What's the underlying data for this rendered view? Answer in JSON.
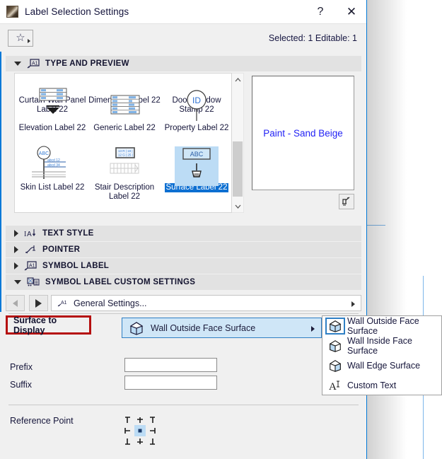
{
  "window": {
    "title": "Label Selection Settings",
    "icon": "archicad-label-icon",
    "help_label": "?",
    "close_label": "✕"
  },
  "toolbar": {
    "favorites_icon": "star-icon",
    "favorites_caret": "caret-right-icon",
    "selection_info": "Selected: 1 Editable: 1"
  },
  "panels": [
    {
      "title": "TYPE AND PREVIEW",
      "icon": "label-a1-icon",
      "expanded": true
    },
    {
      "title": "TEXT STYLE",
      "icon": "text-style-icon",
      "expanded": false
    },
    {
      "title": "POINTER",
      "icon": "pointer-icon",
      "expanded": false
    },
    {
      "title": "SYMBOL LABEL",
      "icon": "symbol-label-icon",
      "expanded": false
    },
    {
      "title": "SYMBOL LABEL CUSTOM SETTINGS",
      "icon": "custom-settings-icon",
      "expanded": true
    }
  ],
  "type_and_preview": {
    "items": [
      {
        "label": "Curtain Wall Panel Label 22",
        "icon": "curtain-wall-panel-label-icon",
        "selected": false,
        "clipped_top": true
      },
      {
        "label": "Dimension Label 22",
        "icon": "dimension-label-icon",
        "selected": false,
        "clipped_top": true
      },
      {
        "label": "Door Window Stamp 22",
        "icon": "door-window-stamp-icon",
        "selected": false,
        "clipped_top": true
      },
      {
        "label": "Elevation Label 22",
        "icon": "elevation-label-icon",
        "selected": false
      },
      {
        "label": "Generic Label 22",
        "icon": "generic-label-icon",
        "selected": false
      },
      {
        "label": "Property Label 22",
        "icon": "property-label-icon",
        "selected": false
      },
      {
        "label": "Skin List Label 22",
        "icon": "skin-list-label-icon",
        "selected": false
      },
      {
        "label": "Stair Description Label 22",
        "icon": "stair-description-label-icon",
        "selected": false
      },
      {
        "label": "Surface Label 22",
        "icon": "surface-label-icon",
        "selected": true
      }
    ],
    "preview_text": "Paint - Sand Beige",
    "preview_tool_icon": "measure-preview-icon",
    "scroll_up_icon": "chevron-up-icon",
    "scroll_down_icon": "chevron-down-icon"
  },
  "custom_settings": {
    "nav_prev_icon": "triangle-left-icon",
    "nav_next_icon": "triangle-right-icon",
    "page_icon": "a1-arrow-icon",
    "page_label": "General Settings...",
    "page_caret_icon": "caret-right-icon",
    "surface_to_display": {
      "label": "Surface to Display",
      "highlight_color": "#b50f0f",
      "value": "Wall Outside Face Surface",
      "value_icon": "cube-outside-face-icon",
      "caret_icon": "caret-right-icon"
    },
    "prefix": {
      "label": "Prefix",
      "value": "",
      "placeholder": ""
    },
    "suffix": {
      "label": "Suffix",
      "value": "",
      "placeholder": ""
    },
    "reference_point": {
      "label": "Reference Point",
      "selected_cell": "center",
      "icon": "reference-point-grid-icon"
    }
  },
  "dropdown": {
    "options": [
      {
        "label": "Wall Outside Face Surface",
        "icon": "cube-outside-face-icon",
        "selected": true
      },
      {
        "label": "Wall Inside Face Surface",
        "icon": "cube-inside-face-icon",
        "selected": false
      },
      {
        "label": "Wall Edge Surface",
        "icon": "cube-edge-face-icon",
        "selected": false
      },
      {
        "label": "Custom Text",
        "icon": "custom-text-a-icon",
        "selected": false
      }
    ]
  },
  "colors": {
    "accent": "#0078d7",
    "selection_blue": "#0d6fd1",
    "selection_fill": "#bcdcf5",
    "highlight_red": "#b50f0f",
    "preview_text": "#2323f5",
    "panel_header": "#e2e2e2",
    "dialog_bg": "#f0f0f0"
  },
  "background": {
    "guides": [
      "guide-line-1",
      "guide-line-2"
    ]
  }
}
